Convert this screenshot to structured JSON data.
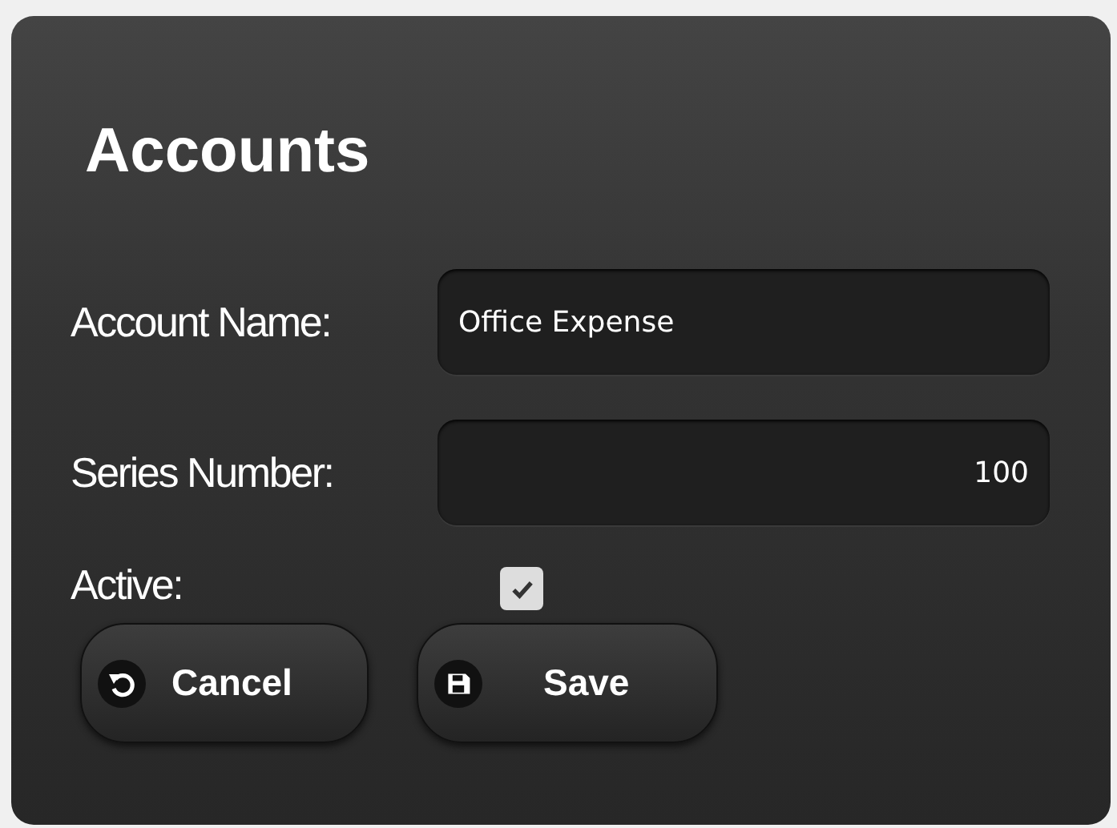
{
  "dialog": {
    "title": "Accounts"
  },
  "fields": [
    {
      "label": "Account Name:",
      "value": "Office Expense",
      "kind": "text"
    },
    {
      "label": "Series Number:",
      "value": "100",
      "kind": "number"
    }
  ],
  "active": {
    "label": "Active:",
    "checked": true
  },
  "buttons": [
    {
      "label": "Cancel",
      "kind": "undo"
    },
    {
      "label": "Save",
      "kind": "save"
    }
  ]
}
